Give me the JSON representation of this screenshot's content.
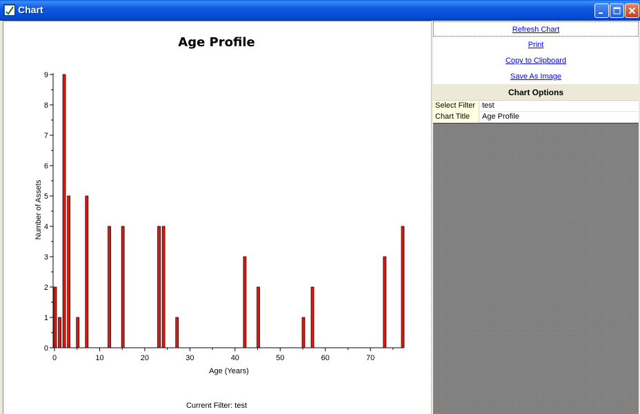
{
  "window": {
    "title": "Chart",
    "colors": {
      "titlebar": "#0448d2",
      "bar_fill": "#d91c12",
      "bar_stroke": "#300000"
    }
  },
  "side": {
    "links": [
      "Refresh Chart",
      "Print",
      "Copy to Clipboard",
      "Save As Image"
    ],
    "options_title": "Chart Options",
    "properties": [
      {
        "key": "Select Filter",
        "value": "test"
      },
      {
        "key": "Chart Title",
        "value": "Age Profile"
      }
    ]
  },
  "chart_data": {
    "type": "bar",
    "title": "Age Profile",
    "xlabel": "Age (Years)",
    "ylabel": "Number of Assets",
    "footer": "Current Filter: test",
    "x": [
      0,
      1,
      2,
      3,
      5,
      7,
      12,
      15,
      23,
      24,
      27,
      42,
      45,
      55,
      57,
      73,
      77
    ],
    "values": [
      2,
      1,
      9,
      5,
      1,
      5,
      4,
      4,
      4,
      4,
      1,
      3,
      2,
      1,
      2,
      3,
      4
    ],
    "xlim": [
      0,
      77
    ],
    "ylim": [
      0,
      9
    ],
    "xticks": [
      0,
      10,
      20,
      30,
      40,
      50,
      60,
      70
    ],
    "yticks": [
      0,
      1,
      2,
      3,
      4,
      5,
      6,
      7,
      8,
      9
    ],
    "grid": false,
    "legend": "none"
  }
}
